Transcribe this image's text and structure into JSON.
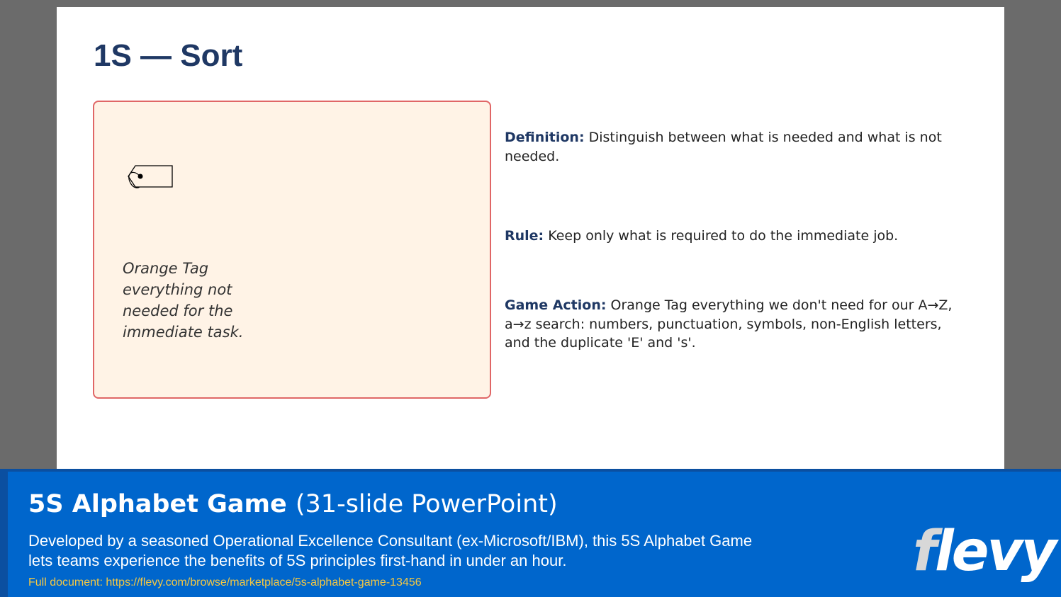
{
  "slide": {
    "title": "1S — Sort",
    "card": {
      "icon": "tag-icon",
      "caption": "Orange Tag everything not needed for the immediate task.",
      "background_color": "#fff3e6",
      "border_color": "#e06666"
    },
    "definition": {
      "label": "Definition:",
      "text": "Distinguish between what is needed and what is not needed."
    },
    "rule": {
      "label": "Rule:",
      "text": "Keep only what is required to do the immediate job."
    },
    "game_action": {
      "label": "Game Action:",
      "text": "Orange Tag everything we don't need for our A→Z, a→z search: numbers, punctuation, symbols, non-English letters, and the duplicate 'E' and 's'."
    }
  },
  "banner": {
    "title_bold": "5S Alphabet Game",
    "title_normal": "(31-slide PowerPoint)",
    "description": "Developed by a seasoned Operational Excellence Consultant (ex-Microsoft/IBM), this 5S Alphabet Game lets teams experience the benefits of 5S principles first-hand in under an hour.",
    "link": "Full document: https://flevy.com/browse/marketplace/5s-alphabet-game-13456",
    "logo_first": "f",
    "logo_rest": "levy",
    "background_color": "#0066cc",
    "link_color": "#f5c842"
  }
}
